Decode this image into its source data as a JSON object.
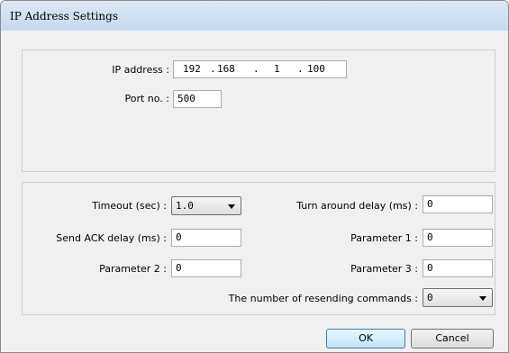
{
  "window": {
    "title": "IP Address Settings"
  },
  "ip": {
    "label": "IP address :",
    "octets": [
      "192",
      "168",
      "1",
      "100"
    ],
    "dots": [
      ".",
      ".",
      "."
    ]
  },
  "port": {
    "label": "Port no. :",
    "value": "500"
  },
  "timeout": {
    "label": "Timeout (sec) :",
    "value": "1.0"
  },
  "turn_around": {
    "label": "Turn around delay (ms) :",
    "value": "0"
  },
  "send_ack": {
    "label": "Send ACK delay (ms) :",
    "value": "0"
  },
  "param1": {
    "label": "Parameter 1 :",
    "value": "0"
  },
  "param2": {
    "label": "Parameter 2 :",
    "value": "0"
  },
  "param3": {
    "label": "Parameter 3 :",
    "value": "0"
  },
  "resend": {
    "label": "The number of resending commands :",
    "value": "0"
  },
  "buttons": {
    "ok": "OK",
    "cancel": "Cancel"
  },
  "icons": {
    "dropdown": "chevron-down-icon"
  }
}
